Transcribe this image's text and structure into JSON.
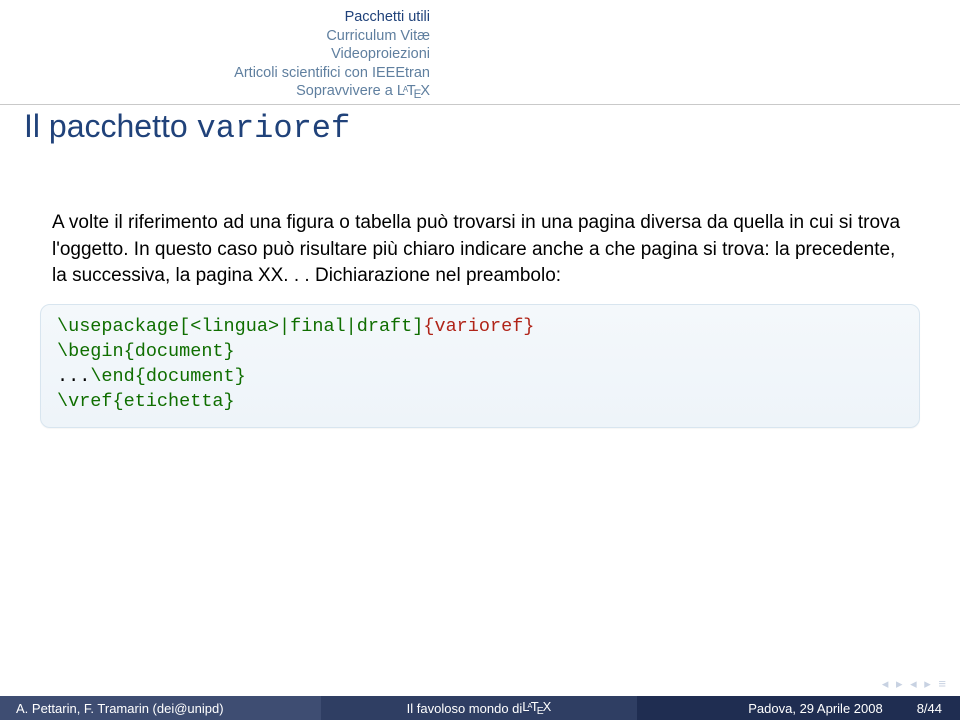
{
  "nav": {
    "items": [
      "Pacchetti utili",
      "Curriculum Vitæ",
      "Videoproiezioni",
      "Articoli scientifici con IEEEtran"
    ],
    "last_prefix": "Sopravvivere a ",
    "last_latex_html": "L<sup>A</sup>T<sub>E</sub>X"
  },
  "title": {
    "prefix": "Il pacchetto ",
    "name": "varioref"
  },
  "body": {
    "para": "A volte il riferimento ad una figura o tabella può trovarsi in una pagina diversa da quella in cui si trova l'oggetto. In questo caso può risultare più chiaro indicare anche a che pagina si trova: la precedente, la successiva, la pagina XX. . . Dichiarazione nel preambolo:"
  },
  "code": {
    "l1_cmd": "\\usepackage",
    "l1_opt": "[<lingua>|final|draft]",
    "l1_arg": "{varioref}",
    "l2_cmd": "\\begin{document}",
    "l3_pre": "...",
    "l3_cmd": "\\end{document}",
    "l4_cmd": "\\vref{etichetta}"
  },
  "footer": {
    "authors": "A. Pettarin, F. Tramarin (dei@unipd)",
    "center_prefix": "Il favoloso mondo di ",
    "center_latex_html": "L<sup>A</sup>T<sub>E</sub>X",
    "right": "Padova, 29 Aprile 2008",
    "page": "8/44"
  },
  "navsym": "◂  ▸  ◂  ▸     ≡"
}
